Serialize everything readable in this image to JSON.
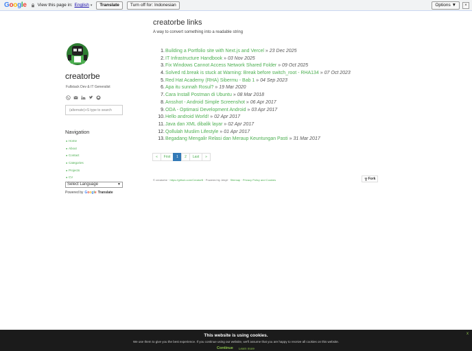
{
  "translate_bar": {
    "view_label": "View this page in:",
    "language": "English",
    "translate_btn": "Translate",
    "turn_off_btn": "Turn off for: Indonesian",
    "options_btn": "Options ▼",
    "close": "×"
  },
  "sidebar": {
    "site_name": "creatorbe",
    "tagline": "Fullstack Dev & IT Generalist",
    "search_placeholder": "(alternate)+S type to search",
    "nav_title": "Navigation",
    "nav_items": [
      "Home",
      "About",
      "Contact",
      "Categories",
      "Projects",
      "CV"
    ],
    "lang_select": "Select Language",
    "powered_by": "Powered by",
    "google": "Google",
    "translate": "Translate"
  },
  "main": {
    "title": "creatorbe links",
    "subtitle": "A way to convert something into a readable string",
    "links": [
      {
        "n": "1.",
        "title": "Building a Portfolio site with Next.js and Vercel",
        "date": "23 Dec 2025"
      },
      {
        "n": "2.",
        "title": "IT Infrastructure Handbook",
        "date": "03 Nov 2025"
      },
      {
        "n": "3.",
        "title": "Fix Windows Cannot Access Network Shared Folder",
        "date": "09 Oct 2025"
      },
      {
        "n": "4.",
        "title": "Solved rd.break is stuck at Warning: Break before switch_root - RHA134",
        "date": "07 Oct 2023"
      },
      {
        "n": "5.",
        "title": "Red Hat Academy (RHA) Sibermu - Bab 1",
        "date": "04 Sep 2023"
      },
      {
        "n": "6.",
        "title": "Apa itu sunnah Rosul?",
        "date": "19 Mar 2020"
      },
      {
        "n": "7.",
        "title": "Cara Install Postman di Ubuntu",
        "date": "08 Mar 2018"
      },
      {
        "n": "8.",
        "title": "Ansshot - Android Simple Screenshot",
        "date": "06 Apr 2017"
      },
      {
        "n": "9.",
        "title": "ODA - Optimasi Development Android",
        "date": "03 Apr 2017"
      },
      {
        "n": "10.",
        "title": "Hello android World!",
        "date": "02 Apr 2017"
      },
      {
        "n": "11.",
        "title": "Java dan XML dibalik layar",
        "date": "02 Apr 2017"
      },
      {
        "n": "12.",
        "title": "Qollulah Muslim Lifestyle",
        "date": "01 Apr 2017"
      },
      {
        "n": "13.",
        "title": "Begadang Mengalir Relasi dan Meraup Keuntungan Pasti",
        "date": "31 Mar 2017"
      }
    ],
    "separator": "»",
    "pager": [
      "«",
      "First",
      "1",
      "2",
      "Last",
      "»"
    ],
    "footer": {
      "copy": "© creatorbe ·",
      "github": "https://github.com/CreatorB",
      "powered": "· Powered by Jekyll ·",
      "sitemap": "Sitemap",
      "sep": "·",
      "privacy": "Privacy Policy and Cookies"
    },
    "fork_label": "Fork"
  },
  "cookie": {
    "title": "This website is using cookies.",
    "message": "We use them to give you the best experience. If you continue using our website, we'll assume that you are happy to receive all cookies on this website.",
    "continue": "Continue",
    "learn_more": "Learn more",
    "close": "x"
  },
  "colors": {
    "accent_green": "#4caf50",
    "pager_active": "#337ab7",
    "cookie_bg": "#1b1b1b"
  }
}
